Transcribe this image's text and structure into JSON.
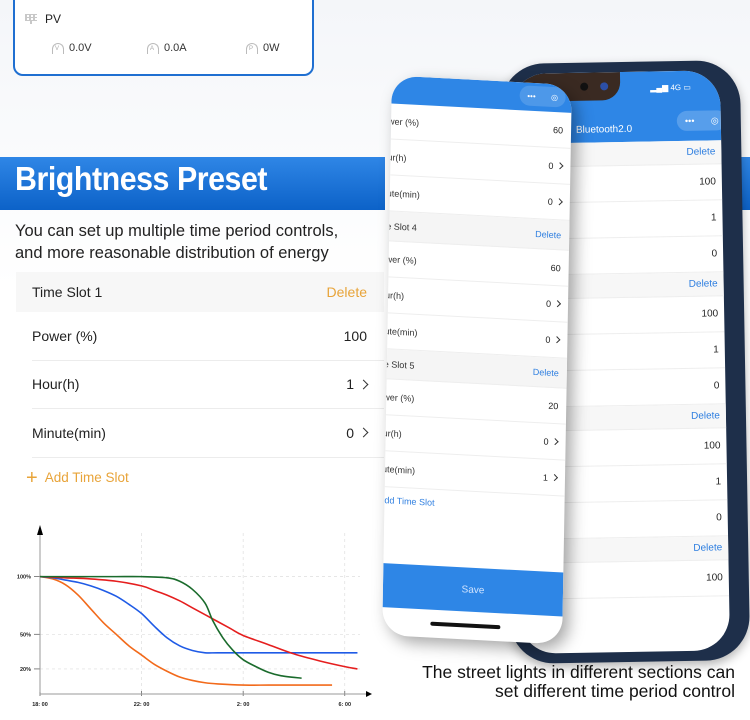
{
  "pv_card": {
    "title": "PV",
    "metrics": [
      {
        "icon": "voltage-gauge-icon",
        "letter": "V",
        "value": "0.0V"
      },
      {
        "icon": "current-gauge-icon",
        "letter": "A",
        "value": "0.0A"
      },
      {
        "icon": "power-gauge-icon",
        "letter": "P",
        "value": "0W"
      }
    ]
  },
  "banner": {
    "title": "Brightness Preset",
    "subtitle_line1": "You can set up multiple time period controls,",
    "subtitle_line2": "and more reasonable distribution of energy"
  },
  "slot_form": {
    "header": "Time Slot 1",
    "delete_label": "Delete",
    "rows": [
      {
        "label": "Power (%)",
        "value": "100",
        "chevron": false
      },
      {
        "label": "Hour(h)",
        "value": "1",
        "chevron": true
      },
      {
        "label": "Minute(min)",
        "value": "0",
        "chevron": true
      }
    ],
    "add_label": "Add Time Slot",
    "accent": "#e8a43a"
  },
  "front_phone": {
    "rows": [
      {
        "type": "row",
        "label": "wer (%)",
        "value": "60",
        "chevron": false
      },
      {
        "type": "row",
        "label": "ur(h)",
        "value": "0",
        "chevron": true
      },
      {
        "type": "row",
        "label": "ute(min)",
        "value": "0",
        "chevron": true
      },
      {
        "type": "header",
        "label": "e Slot 4",
        "value": "Delete"
      },
      {
        "type": "row",
        "label": "wer (%)",
        "value": "60",
        "chevron": false
      },
      {
        "type": "row",
        "label": "ur(h)",
        "value": "0",
        "chevron": true
      },
      {
        "type": "row",
        "label": "ute(min)",
        "value": "0",
        "chevron": true
      },
      {
        "type": "header",
        "label": "e Slot 5",
        "value": "Delete"
      },
      {
        "type": "row",
        "label": "wer (%)",
        "value": "20",
        "chevron": false
      },
      {
        "type": "row",
        "label": "ur(h)",
        "value": "0",
        "chevron": true
      },
      {
        "type": "row",
        "label": "ute(min)",
        "value": "1",
        "chevron": true
      }
    ],
    "add_label": "dd Time Slot",
    "save_label": "Save",
    "accent": "#2e86e6"
  },
  "back_phone": {
    "title": "Bluetooth2.0",
    "status": "4G",
    "rows": [
      {
        "type": "header",
        "value": "Delete"
      },
      {
        "type": "row",
        "value": "100"
      },
      {
        "type": "row",
        "value": "1"
      },
      {
        "type": "row",
        "value": "0"
      },
      {
        "type": "header",
        "value": "Delete"
      },
      {
        "type": "row",
        "value": "100"
      },
      {
        "type": "row",
        "value": "1"
      },
      {
        "type": "row",
        "value": "0"
      },
      {
        "type": "header",
        "value": "Delete"
      },
      {
        "type": "row",
        "value": "100"
      },
      {
        "type": "row",
        "value": "1"
      },
      {
        "type": "row",
        "value": "0"
      },
      {
        "type": "header",
        "value": "Delete"
      },
      {
        "type": "row",
        "value": "100"
      }
    ]
  },
  "caption": {
    "line1": "The street lights in different sections can",
    "line2": "set different time period control"
  },
  "chart_data": {
    "type": "line",
    "title": "",
    "xlabel": "",
    "ylabel": "",
    "x_ticks": [
      "18: 00",
      "22: 00",
      "2: 00",
      "6: 00"
    ],
    "x_tick_hours": [
      0,
      4,
      8,
      12
    ],
    "y_ticks": [
      "100%",
      "50%",
      "20%"
    ],
    "y_tick_values": [
      100,
      50,
      20
    ],
    "xlim": [
      0,
      12.6
    ],
    "ylim": [
      0,
      130
    ],
    "grid": "dashed",
    "series": [
      {
        "name": "orange",
        "color": "#f26a1b",
        "x": [
          0,
          0.5,
          1,
          1.5,
          2,
          2.5,
          3,
          3.5,
          4,
          4.5,
          5,
          5.5,
          6,
          6.5,
          7,
          8,
          9,
          10,
          11.5
        ],
        "y": [
          100,
          98,
          93,
          84,
          72,
          60,
          50,
          40,
          32,
          24,
          18,
          13,
          10,
          8,
          7,
          6,
          6,
          6,
          6
        ]
      },
      {
        "name": "blue",
        "color": "#1f5be6",
        "x": [
          0,
          0.5,
          1,
          1.5,
          2,
          2.5,
          3,
          3.5,
          4,
          4.5,
          5,
          5.5,
          6,
          6.5,
          7,
          8,
          9,
          10,
          11,
          12.5
        ],
        "y": [
          100,
          99,
          97,
          95,
          92,
          88,
          83,
          76,
          68,
          57,
          47,
          40,
          36,
          34,
          34,
          34,
          34,
          34,
          34,
          34
        ]
      },
      {
        "name": "red",
        "color": "#e51e1e",
        "x": [
          0,
          1,
          2,
          3,
          4,
          4.5,
          5,
          5.5,
          6,
          6.5,
          7,
          7.5,
          8,
          9,
          10,
          11,
          12,
          12.5
        ],
        "y": [
          100,
          99,
          98,
          96,
          92,
          88,
          84,
          79,
          73,
          67,
          61,
          55,
          49,
          41,
          33,
          27,
          22,
          20
        ]
      },
      {
        "name": "green",
        "color": "#1a6b2c",
        "x": [
          0,
          1,
          2,
          3,
          4,
          5,
          5.5,
          6,
          6.5,
          6.8,
          7.2,
          7.6,
          8,
          8.5,
          9,
          9.5,
          10.3
        ],
        "y": [
          100,
          100,
          100,
          100,
          100,
          99,
          96,
          89,
          77,
          62,
          47,
          36,
          28,
          22,
          17,
          14,
          12
        ]
      }
    ]
  }
}
